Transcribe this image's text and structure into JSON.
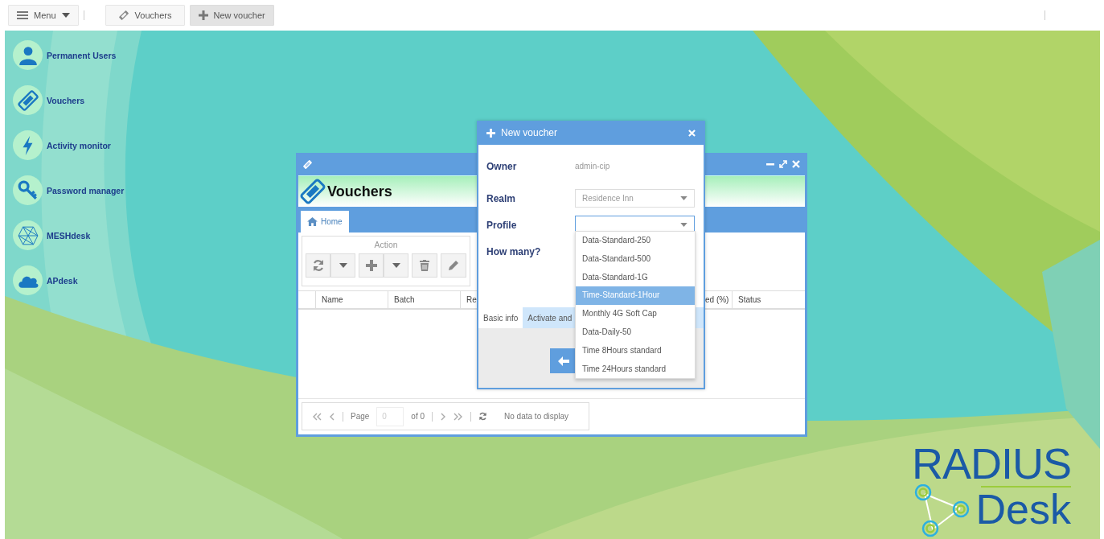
{
  "menu_button": {
    "label": "Menu"
  },
  "taskbar": [
    {
      "label": "Vouchers",
      "kind": "ticket",
      "selected": false
    },
    {
      "label": "New voucher",
      "kind": "add",
      "selected": true
    }
  ],
  "desktop_icons": [
    {
      "label": "Permanent Users",
      "kind": "user"
    },
    {
      "label": "Vouchers",
      "kind": "ticket"
    },
    {
      "label": "Activity monitor",
      "kind": "bolt"
    },
    {
      "label": "Password manager",
      "kind": "key"
    },
    {
      "label": "MESHdesk",
      "kind": "mesh"
    },
    {
      "label": "APdesk",
      "kind": "cloud"
    }
  ],
  "vouchers_window": {
    "heading": "Vouchers",
    "tabs": [
      {
        "label": "Home",
        "selected": true
      }
    ],
    "action_group": {
      "title": "Action"
    },
    "columns": [
      "Name",
      "Batch",
      "Re",
      "ed (%)",
      "Status"
    ],
    "paging": {
      "page_label": "Page",
      "page_value": "0",
      "page_total": "of 0",
      "message": "No data to display"
    }
  },
  "new_voucher_dialog": {
    "title": "New voucher",
    "fields": [
      {
        "label": "Owner",
        "kind": "display",
        "value": "admin-cip"
      },
      {
        "label": "Realm",
        "kind": "combo",
        "value": "Residence Inn",
        "focused": false
      },
      {
        "label": "Profile",
        "kind": "combo",
        "focused": true
      },
      {
        "label": "How many?",
        "kind": "label"
      }
    ],
    "tabs": [
      {
        "label": "Basic info",
        "selected": true
      },
      {
        "label": "Activate and",
        "selected": false
      }
    ],
    "profile_options": [
      {
        "label": "Data-Standard-250",
        "selected": false
      },
      {
        "label": "Data-Standard-500",
        "selected": false
      },
      {
        "label": "Data-Standard-1G",
        "selected": false
      },
      {
        "label": "Time-Standard-1Hour",
        "selected": true
      },
      {
        "label": "Monthly 4G Soft Cap",
        "selected": false
      },
      {
        "label": "Data-Daily-50",
        "selected": false
      },
      {
        "label": "Time 8Hours standard",
        "selected": false
      },
      {
        "label": "Time 24Hours standard",
        "selected": false
      }
    ]
  },
  "logo": {
    "top": "RADIUS",
    "bottom": "Desk"
  }
}
